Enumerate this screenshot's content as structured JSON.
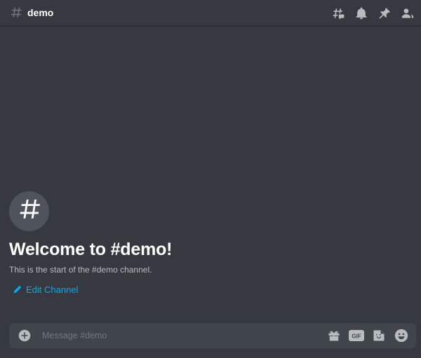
{
  "header": {
    "channel_name": "demo",
    "icons": [
      "threads-icon",
      "notification-bell-icon",
      "pin-icon",
      "member-list-icon"
    ]
  },
  "welcome": {
    "heading": "Welcome to #demo!",
    "subtitle": "This is the start of the #demo channel.",
    "edit_label": "Edit Channel"
  },
  "composer": {
    "placeholder": "Message #demo",
    "gif_label": "GIF"
  },
  "colors": {
    "background": "#36393f",
    "composer": "#40444b",
    "link": "#00aff4",
    "icon": "#b9bbbe"
  }
}
